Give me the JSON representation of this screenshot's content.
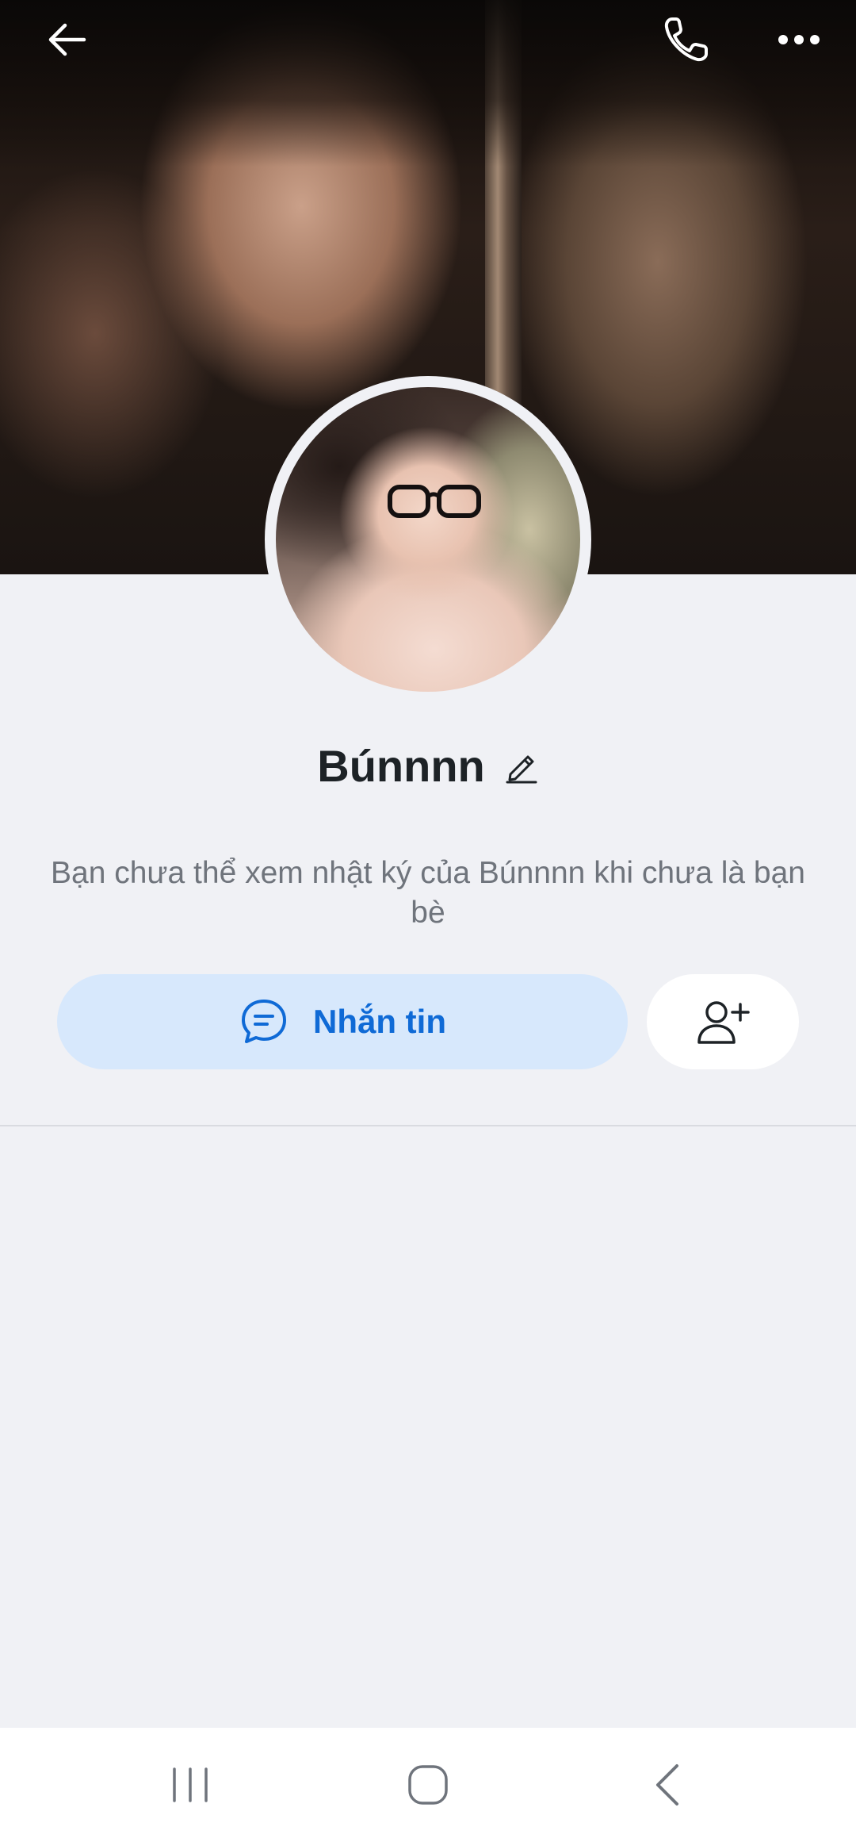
{
  "header": {
    "back_icon": "arrow-left-icon",
    "call_icon": "phone-icon",
    "more_icon": "more-horizontal-icon"
  },
  "profile": {
    "name": "Búnnnn",
    "edit_icon": "pencil-icon",
    "notice": "Bạn chưa thể xem nhật ký của Búnnnn khi chưa là bạn bè"
  },
  "actions": {
    "message_label": "Nhắn tin",
    "message_icon": "chat-bubble-icon",
    "add_friend_icon": "add-user-icon"
  },
  "system_nav": {
    "recents_icon": "recents-icon",
    "home_icon": "home-icon",
    "back_icon": "back-chevron-icon"
  },
  "colors": {
    "background": "#f0f1f5",
    "accent": "#0f6ad6",
    "accent_soft": "#d7e8fc",
    "text_primary": "#1d2226",
    "text_secondary": "#6f747c"
  }
}
